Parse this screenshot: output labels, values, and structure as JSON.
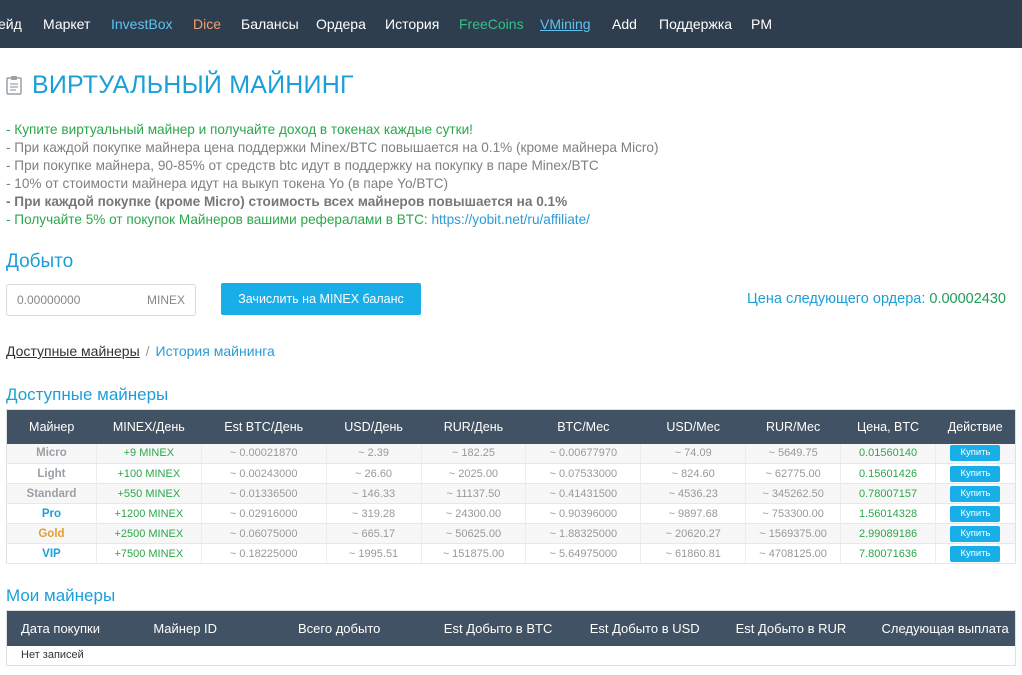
{
  "nav": {
    "items": [
      {
        "label": "ейд"
      },
      {
        "label": "Маркет"
      },
      {
        "label": "InvestBox"
      },
      {
        "label": "Dice"
      },
      {
        "label": "Балансы"
      },
      {
        "label": "Ордера"
      },
      {
        "label": "История"
      },
      {
        "label": "FreeCoins"
      },
      {
        "label": "VMining"
      },
      {
        "label": "Add"
      },
      {
        "label": "Поддержка"
      },
      {
        "label": "PM"
      }
    ]
  },
  "page": {
    "title": "ВИРТУАЛЬНЫЙ МАЙНИНГ",
    "title_icon": "clipboard-icon"
  },
  "info": {
    "line1": "- Купите виртуальный майнер и получайте доход в токенах каждые сутки!",
    "line2": "- При каждой покупке майнера цена поддержки Minex/BTC повышается на 0.1% (кроме майнера Micro)",
    "line3": "- При покупке майнера, 90-85% от средств btc идут в поддержку на покупку в паре Minex/BTC",
    "line4": "- 10% от стоимости майнера идут на выкуп токена Yo (в паре Yo/BTC)",
    "line5": "- При каждой покупке (кроме Micro) стоимость всех майнеров повышается на 0.1%",
    "line6_text": "- Получайте 5% от покупок Майнеров вашими рефералами в BTC: ",
    "line6_link": "https://yobit.net/ru/affiliate/"
  },
  "mined": {
    "title": "Добыто",
    "value": "0.00000000",
    "unit": "MINEX",
    "credit_button": "Зачислить на MINEX баланс",
    "next_price_label": "Цена следующего ордера: ",
    "next_price_value": "0.00002430"
  },
  "crumbs": {
    "active": "Доступные майнеры",
    "separator": "/",
    "inactive": "История майнинга"
  },
  "available": {
    "title": "Доступные майнеры",
    "headers": [
      "Майнер",
      "MINEX/День",
      "Est BTC/День",
      "USD/День",
      "RUR/День",
      "BTC/Мес",
      "USD/Мес",
      "RUR/Мес",
      "Цена, BTC",
      "Действие"
    ],
    "buy_label": "Купить",
    "rows": [
      {
        "name": "Micro",
        "minex": "+9 MINEX",
        "btc_day": "~ 0.00021870",
        "usd_day": "~ 2.39",
        "rur_day": "~ 182.25",
        "btc_mon": "~ 0.00677970",
        "usd_mon": "~ 74.09",
        "rur_mon": "~ 5649.75",
        "price": "0.01560140",
        "color": "#9aa0a6"
      },
      {
        "name": "Light",
        "minex": "+100 MINEX",
        "btc_day": "~ 0.00243000",
        "usd_day": "~ 26.60",
        "rur_day": "~ 2025.00",
        "btc_mon": "~ 0.07533000",
        "usd_mon": "~ 824.60",
        "rur_mon": "~ 62775.00",
        "price": "0.15601426",
        "color": "#9aa0a6"
      },
      {
        "name": "Standard",
        "minex": "+550 MINEX",
        "btc_day": "~ 0.01336500",
        "usd_day": "~ 146.33",
        "rur_day": "~ 11137.50",
        "btc_mon": "~ 0.41431500",
        "usd_mon": "~ 4536.23",
        "rur_mon": "~ 345262.50",
        "price": "0.78007157",
        "color": "#9aa0a6"
      },
      {
        "name": "Pro",
        "minex": "+1200 MINEX",
        "btc_day": "~ 0.02916000",
        "usd_day": "~ 319.28",
        "rur_day": "~ 24300.00",
        "btc_mon": "~ 0.90396000",
        "usd_mon": "~ 9897.68",
        "rur_mon": "~ 753300.00",
        "price": "1.56014328",
        "color": "#1a9fd9"
      },
      {
        "name": "Gold",
        "minex": "+2500 MINEX",
        "btc_day": "~ 0.06075000",
        "usd_day": "~ 665.17",
        "rur_day": "~ 50625.00",
        "btc_mon": "~ 1.88325000",
        "usd_mon": "~ 20620.27",
        "rur_mon": "~ 1569375.00",
        "price": "2.99089186",
        "color": "#e0a030"
      },
      {
        "name": "VIP",
        "minex": "+7500 MINEX",
        "btc_day": "~ 0.18225000",
        "usd_day": "~ 1995.51",
        "rur_day": "~ 151875.00",
        "btc_mon": "~ 5.64975000",
        "usd_mon": "~ 61860.81",
        "rur_mon": "~ 4708125.00",
        "price": "7.80071636",
        "color": "#1a9fd9"
      }
    ]
  },
  "mine": {
    "title": "Мои майнеры",
    "headers": [
      "Дата покупки",
      "Майнер ID",
      "Всего добыто",
      "Est Добыто в BTC",
      "Est Добыто в USD",
      "Est Добыто в RUR",
      "Следующая выплата"
    ],
    "empty": "Нет записей"
  }
}
